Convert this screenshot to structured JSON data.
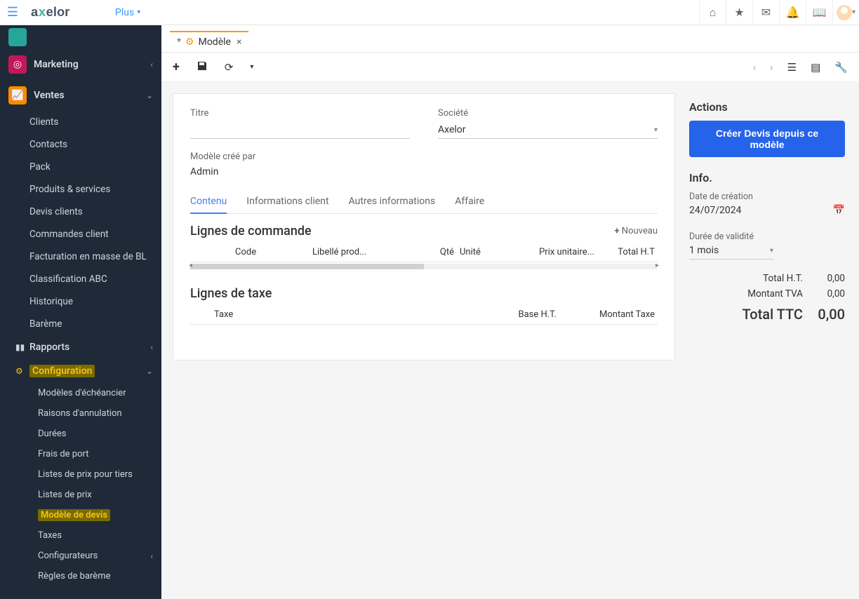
{
  "topbar": {
    "plus_label": "Plus"
  },
  "sidebar": {
    "marketing": "Marketing",
    "ventes": "Ventes",
    "clients": "Clients",
    "contacts": "Contacts",
    "pack": "Pack",
    "produits": "Produits & services",
    "devis_clients": "Devis clients",
    "commandes_client": "Commandes client",
    "facturation": "Facturation en masse de BL",
    "classification": "Classification ABC",
    "historique": "Historique",
    "bareme": "Barème",
    "rapports": "Rapports",
    "configuration": "Configuration",
    "modeles_echeancier": "Modèles d'échéancier",
    "raisons_annulation": "Raisons d'annulation",
    "durees": "Durées",
    "frais_port": "Frais de port",
    "listes_prix_tiers": "Listes de prix pour tiers",
    "listes_prix": "Listes de prix",
    "modele_devis": "Modèle de devis",
    "taxes": "Taxes",
    "configurateurs": "Configurateurs",
    "regles_bareme": "Règles de barème"
  },
  "tab": {
    "dirty": "*",
    "title": "Modèle"
  },
  "form": {
    "titre_label": "Titre",
    "societe_label": "Société",
    "societe_value": "Axelor",
    "modele_cree_label": "Modèle créé par",
    "modele_cree_value": "Admin"
  },
  "subtabs": {
    "contenu": "Contenu",
    "informations_client": "Informations client",
    "autres_informations": "Autres informations",
    "affaire": "Affaire"
  },
  "order_lines": {
    "title": "Lignes de commande",
    "new": "Nouveau",
    "cols": {
      "code": "Code",
      "libelle": "Libellé prod...",
      "qte": "Qté",
      "unite": "Unité",
      "prix": "Prix unitaire...",
      "total": "Total H.T"
    }
  },
  "tax_lines": {
    "title": "Lignes de taxe",
    "cols": {
      "taxe": "Taxe",
      "base": "Base H.T.",
      "montant": "Montant Taxe"
    }
  },
  "actions": {
    "title": "Actions",
    "create_quote": "Créer Devis depuis ce modèle"
  },
  "info": {
    "title": "Info.",
    "date_label": "Date de création",
    "date_value": "24/07/2024",
    "duree_label": "Durée de validité",
    "duree_value": "1 mois",
    "total_ht_label": "Total H.T.",
    "total_ht_value": "0,00",
    "tva_label": "Montant TVA",
    "tva_value": "0,00",
    "ttc_label": "Total TTC",
    "ttc_value": "0,00"
  }
}
